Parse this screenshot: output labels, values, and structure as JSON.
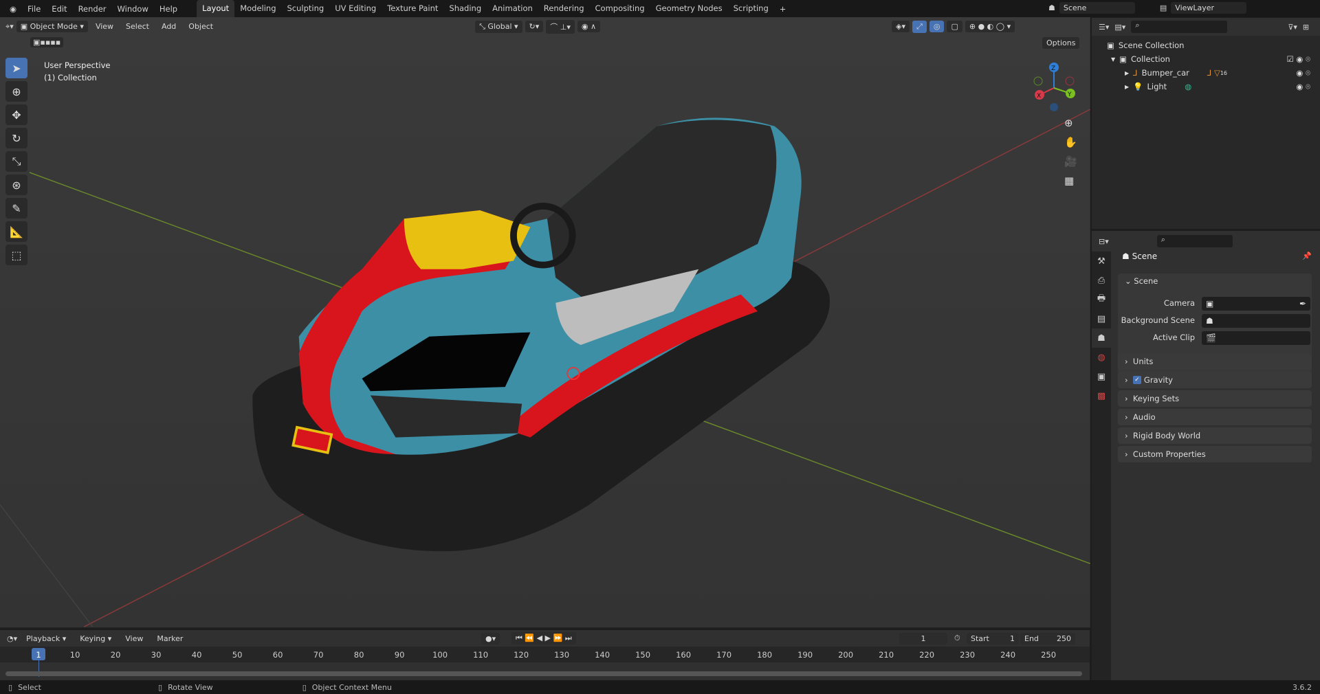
{
  "topbar": {
    "menus": [
      "File",
      "Edit",
      "Render",
      "Window",
      "Help"
    ],
    "workspaces": [
      "Layout",
      "Modeling",
      "Sculpting",
      "UV Editing",
      "Texture Paint",
      "Shading",
      "Animation",
      "Rendering",
      "Compositing",
      "Geometry Nodes",
      "Scripting"
    ],
    "add": "+",
    "scene": "Scene",
    "view_layer": "ViewLayer"
  },
  "viewport": {
    "mode": "Object Mode",
    "menus": [
      "View",
      "Select",
      "Add",
      "Object"
    ],
    "orientation": "Global",
    "options": "Options",
    "info_line1": "User Perspective",
    "info_line2": "(1) Collection",
    "gizmo": {
      "x": "X",
      "y": "Y",
      "z": "Z"
    }
  },
  "outliner": {
    "items": [
      {
        "label": "Scene Collection"
      },
      {
        "label": "Collection"
      },
      {
        "label": "Bumper_car",
        "badge": "16"
      },
      {
        "label": "Light"
      }
    ]
  },
  "properties": {
    "header": "Scene",
    "scene_panel": "Scene",
    "camera_label": "Camera",
    "background_label": "Background Scene",
    "clip_label": "Active Clip",
    "sections": [
      "Units",
      "Gravity",
      "Keying Sets",
      "Audio",
      "Rigid Body World",
      "Custom Properties"
    ],
    "gravity_checked": true
  },
  "timeline": {
    "menus": [
      "Playback",
      "Keying",
      "View",
      "Marker"
    ],
    "current_frame": "1",
    "start_label": "Start",
    "start": "1",
    "end_label": "End",
    "end": "250",
    "ticks": [
      "1",
      "10",
      "20",
      "30",
      "40",
      "50",
      "60",
      "70",
      "80",
      "90",
      "100",
      "110",
      "120",
      "130",
      "140",
      "150",
      "160",
      "170",
      "180",
      "190",
      "200",
      "210",
      "220",
      "230",
      "240",
      "250"
    ]
  },
  "status": {
    "select": "Select",
    "rotate": "Rotate View",
    "context": "Object Context Menu",
    "version": "3.6.2"
  },
  "colors": {
    "accent": "#4772b3",
    "car_blue": "#3d8fa6",
    "car_red": "#d8151c",
    "car_yellow": "#e8c011"
  }
}
